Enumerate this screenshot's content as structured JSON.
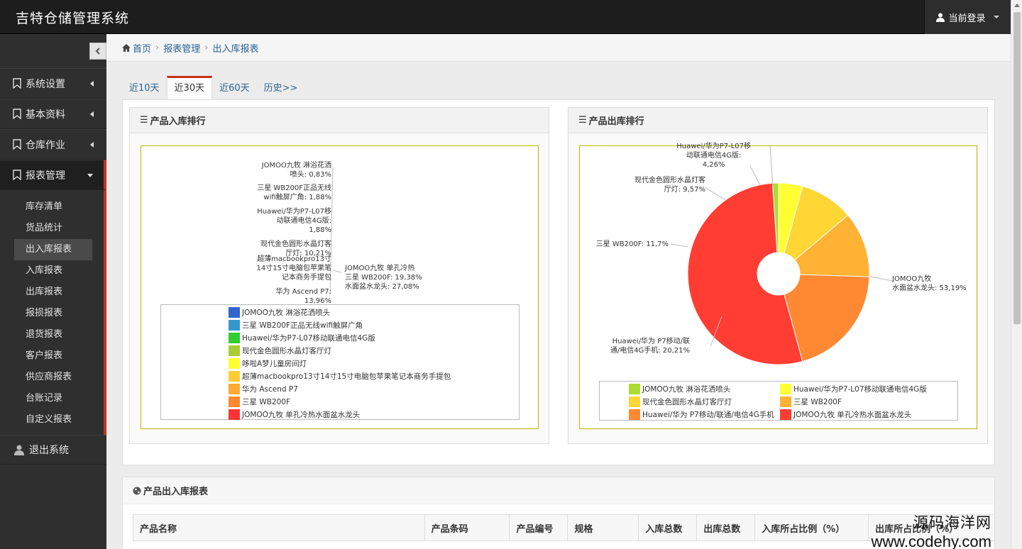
{
  "app": {
    "title": "吉特仓储管理系统",
    "user_menu": "当前登录"
  },
  "sidebar": {
    "collapse_icon": "chevron-left-icon",
    "items": [
      {
        "label": "系统设置",
        "icon": "bookmark-icon"
      },
      {
        "label": "基本资料",
        "icon": "bookmark-icon"
      },
      {
        "label": "仓库作业",
        "icon": "bookmark-icon"
      },
      {
        "label": "报表管理",
        "icon": "bookmark-icon",
        "expanded": true
      }
    ],
    "sub_items": [
      "库存清单",
      "货品统计",
      "出入库报表",
      "入库报表",
      "出库报表",
      "报损报表",
      "退货报表",
      "客户报表",
      "供应商报表",
      "台账记录",
      "自定义报表"
    ],
    "active_sub": "出入库报表",
    "logout": "退出系统"
  },
  "breadcrumb": {
    "home": "首页",
    "section": "报表管理",
    "page": "出入库报表"
  },
  "tabs": [
    "近10天",
    "近30天",
    "近60天",
    "历史>>"
  ],
  "active_tab": "近30天",
  "panels": {
    "in_title": "产品入库排行",
    "out_title": "产品出库排行"
  },
  "in_labels": [
    "JOMOO九牧 淋浴花洒",
    "喷头: 0,83%",
    "三星 WB200F正品无线",
    "wifi触屏广角: 1,88%",
    "Huawei/华为P7-L07移",
    "动联通电信4G版:",
    "1,88%",
    "现代金色圆形水晶灯客",
    "厅灯: 10,21%",
    "超薄macbookpro13寸",
    "14寸15寸电脑包苹果笔",
    "记本商务手提包",
    "华为 Ascend P7:",
    "13,96%",
    "JOMOO九牧 单孔冷热",
    "三星 WB200F: 19,38%",
    "水面盆水龙头: 27,08%"
  ],
  "out_labels": {
    "huawei_l07": [
      "Huawei/华为P7-L07移",
      "动联通电信4G版:",
      "4,26%"
    ],
    "lamp": [
      "现代金色圆形水晶灯客",
      "厅灯: 9,57%"
    ],
    "samsung": [
      "三星 WB200F: 11,7%"
    ],
    "huawei_p7": [
      "Huawei/华为 P7移动/联",
      "通/电信4G手机: 20,21%"
    ],
    "jomoo": [
      "JOMOO九牧",
      "水面盆水龙头: 53,19%"
    ]
  },
  "chart_data": [
    {
      "type": "pie",
      "title": "产品入库排行",
      "series": [
        {
          "name": "JOMOO九牧 淋浴花洒喷头",
          "value": 0.83,
          "color": "#3366cc"
        },
        {
          "name": "三星 WB200F正品无线wifi触屏广角",
          "value": 1.88,
          "color": "#3399cc"
        },
        {
          "name": "Huawei/华为P7-L07移动联通电信4G版",
          "value": 1.88,
          "color": "#33cc33"
        },
        {
          "name": "现代金色圆形水晶灯客厅灯",
          "value": 10.21,
          "color": "#aacc33"
        },
        {
          "name": "哆啦A梦儿童房间灯",
          "value": null,
          "color": "#ffff33"
        },
        {
          "name": "超薄macbookpro13寸14寸15寸电脑包苹果笔记本商务手提包",
          "value": null,
          "color": "#ffcc33"
        },
        {
          "name": "华为 Ascend P7",
          "value": 13.96,
          "color": "#ffaa33"
        },
        {
          "name": "三星 WB200F",
          "value": 19.38,
          "color": "#ff8833"
        },
        {
          "name": "JOMOO九牧 单孔冷热水面盆水龙头",
          "value": 27.08,
          "color": "#ff3333"
        }
      ]
    },
    {
      "type": "pie",
      "title": "产品出库排行",
      "series": [
        {
          "name": "JOMOO九牧 淋浴花洒喷头",
          "value": 1.06,
          "color": "#aadd33"
        },
        {
          "name": "Huawei/华为P7-L07移动联通电信4G版",
          "value": 4.26,
          "color": "#ffff33"
        },
        {
          "name": "现代金色圆形水晶灯客厅灯",
          "value": 9.57,
          "color": "#ffd633"
        },
        {
          "name": "三星 WB200F",
          "value": 11.7,
          "color": "#ffb233"
        },
        {
          "name": "Huawei/华为 P7移动/联通/电信4G手机",
          "value": 20.21,
          "color": "#ff8833"
        },
        {
          "name": "JOMOO九牧 单孔冷热水面盆水龙头",
          "value": 53.19,
          "color": "#ff3d33"
        }
      ]
    }
  ],
  "report": {
    "title": "产品出入库报表",
    "columns": [
      "产品名称",
      "产品条码",
      "产品编号",
      "规格",
      "入库总数",
      "出库总数",
      "入库所占比例（%）",
      "出库所占比例（%）"
    ]
  },
  "watermark": {
    "line1": "源码海洋网",
    "line2": "www.codehy.com"
  }
}
